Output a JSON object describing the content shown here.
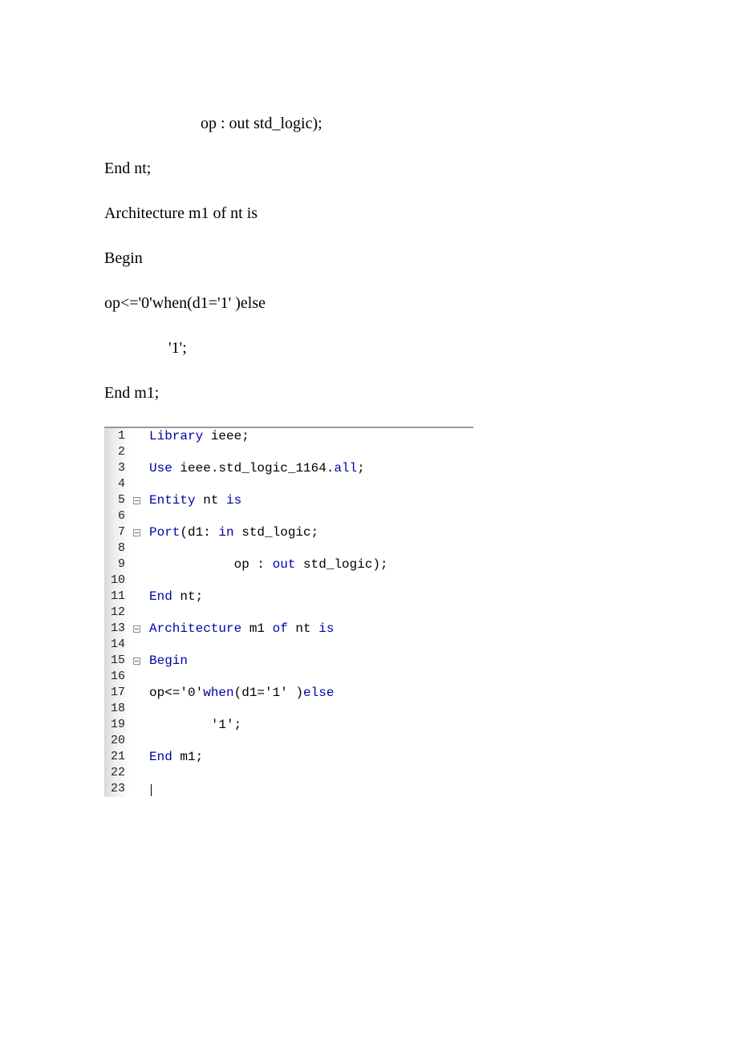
{
  "prose": {
    "l1": "op : out std_logic);",
    "l2": "End nt;",
    "l3": "Architecture m1 of nt is",
    "l4": "Begin",
    "l5": "op<='0'when(d1='1' )else",
    "l6": "'1';",
    "l7": "End m1;"
  },
  "editor": {
    "lines": [
      {
        "num": "1",
        "fold": false,
        "segments": [
          {
            "t": "Library",
            "kw": true
          },
          {
            "t": " ieee;"
          }
        ]
      },
      {
        "num": "2",
        "fold": false,
        "segments": []
      },
      {
        "num": "3",
        "fold": false,
        "segments": [
          {
            "t": "Use",
            "kw": true
          },
          {
            "t": " ieee.std_logic_1164."
          },
          {
            "t": "all",
            "kw": true
          },
          {
            "t": ";"
          }
        ]
      },
      {
        "num": "4",
        "fold": false,
        "segments": []
      },
      {
        "num": "5",
        "fold": true,
        "segments": [
          {
            "t": "Entity",
            "kw": true
          },
          {
            "t": " nt "
          },
          {
            "t": "is",
            "kw": true
          }
        ]
      },
      {
        "num": "6",
        "fold": false,
        "segments": []
      },
      {
        "num": "7",
        "fold": true,
        "segments": [
          {
            "t": "Port",
            "kw": true
          },
          {
            "t": "(d1: "
          },
          {
            "t": "in",
            "kw": true
          },
          {
            "t": " std_logic;"
          }
        ]
      },
      {
        "num": "8",
        "fold": false,
        "segments": []
      },
      {
        "num": "9",
        "fold": false,
        "segments": [
          {
            "t": "           op : "
          },
          {
            "t": "out",
            "kw": true
          },
          {
            "t": " std_logic);"
          }
        ]
      },
      {
        "num": "10",
        "fold": false,
        "segments": []
      },
      {
        "num": "11",
        "fold": false,
        "segments": [
          {
            "t": "End",
            "kw": true
          },
          {
            "t": " nt;"
          }
        ]
      },
      {
        "num": "12",
        "fold": false,
        "segments": []
      },
      {
        "num": "13",
        "fold": true,
        "segments": [
          {
            "t": "Architecture",
            "kw": true
          },
          {
            "t": " m1 "
          },
          {
            "t": "of",
            "kw": true
          },
          {
            "t": " nt "
          },
          {
            "t": "is",
            "kw": true
          }
        ]
      },
      {
        "num": "14",
        "fold": false,
        "segments": []
      },
      {
        "num": "15",
        "fold": true,
        "segments": [
          {
            "t": "Begin",
            "kw": true
          }
        ]
      },
      {
        "num": "16",
        "fold": false,
        "segments": []
      },
      {
        "num": "17",
        "fold": false,
        "segments": [
          {
            "t": "op<='0'"
          },
          {
            "t": "when",
            "kw": true
          },
          {
            "t": "(d1='1' )"
          },
          {
            "t": "else",
            "kw": true
          }
        ]
      },
      {
        "num": "18",
        "fold": false,
        "segments": []
      },
      {
        "num": "19",
        "fold": false,
        "segments": [
          {
            "t": "        '1';"
          }
        ]
      },
      {
        "num": "20",
        "fold": false,
        "segments": []
      },
      {
        "num": "21",
        "fold": false,
        "segments": [
          {
            "t": "End",
            "kw": true
          },
          {
            "t": " m1;"
          }
        ]
      },
      {
        "num": "22",
        "fold": false,
        "segments": []
      },
      {
        "num": "23",
        "fold": false,
        "segments": [],
        "cursor": true
      }
    ]
  }
}
